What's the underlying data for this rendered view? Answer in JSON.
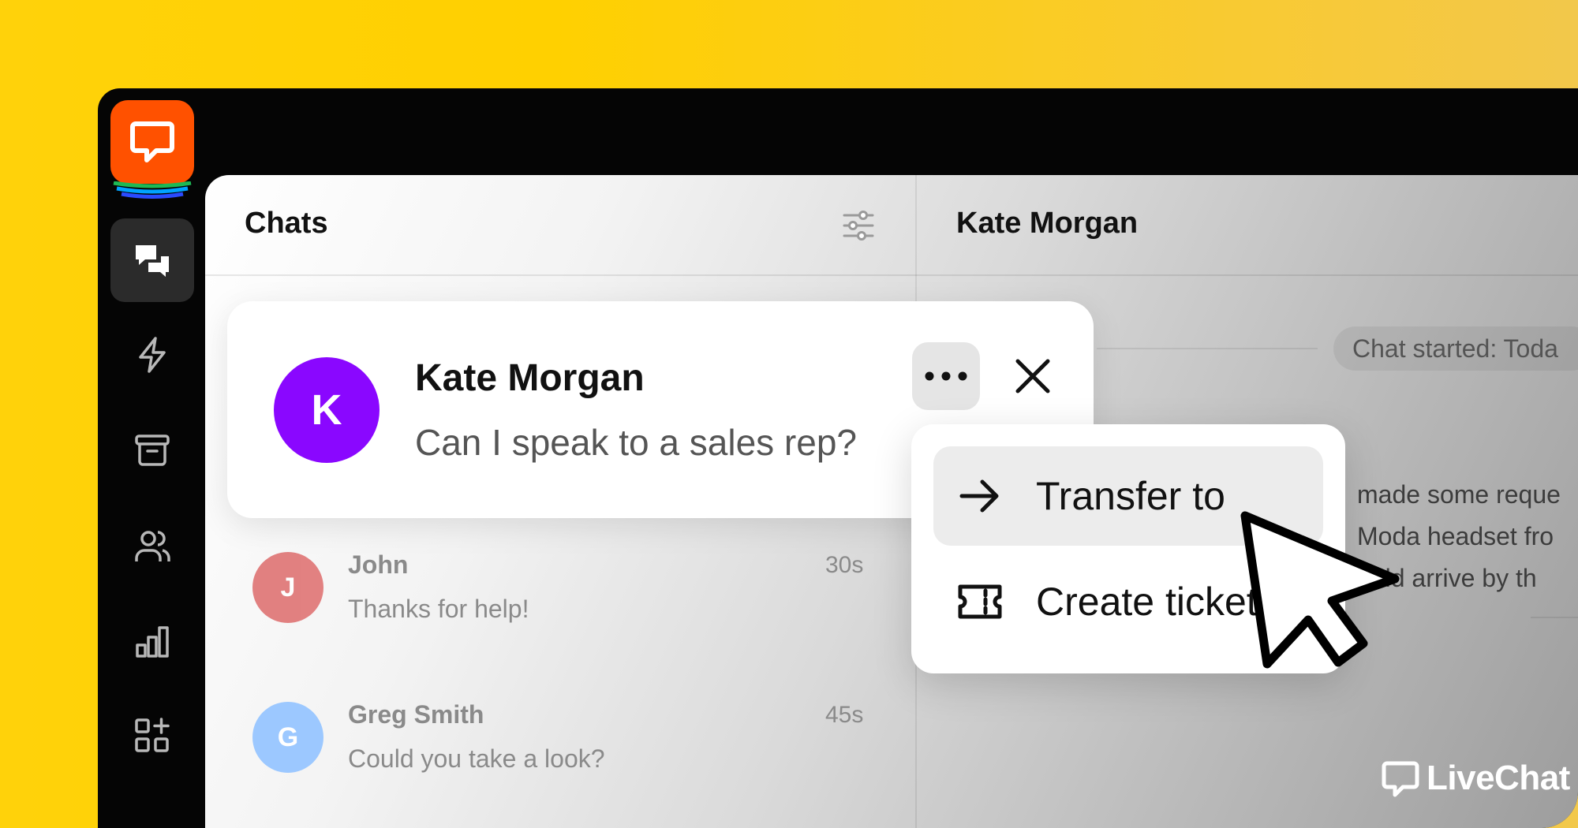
{
  "sidebar": {
    "nav": [
      {
        "name": "chats",
        "icon": "chat-bubbles-icon",
        "active": true
      },
      {
        "name": "automate",
        "icon": "lightning-icon",
        "active": false
      },
      {
        "name": "archives",
        "icon": "archive-box-icon",
        "active": false
      },
      {
        "name": "customers",
        "icon": "people-icon",
        "active": false
      },
      {
        "name": "reports",
        "icon": "bar-chart-icon",
        "active": false
      },
      {
        "name": "apps",
        "icon": "apps-grid-icon",
        "active": false
      }
    ]
  },
  "chat_list": {
    "title": "Chats",
    "filter_icon": "sliders-icon",
    "selected": {
      "initial": "K",
      "name": "Kate Morgan",
      "message": "Can I speak to a sales rep?",
      "avatar_color": "#8A07FF"
    },
    "items": [
      {
        "initial": "J",
        "name": "John",
        "time": "30s",
        "message": "Thanks for help!",
        "avatar_color": "#E07A7A"
      },
      {
        "initial": "G",
        "name": "Greg Smith",
        "time": "45s",
        "message": "Could you take a look?",
        "avatar_color": "#9CC8FF"
      }
    ]
  },
  "menu": {
    "items": [
      {
        "label": "Transfer to",
        "icon": "arrow-right-icon"
      },
      {
        "label": "Create ticket",
        "icon": "ticket-icon"
      }
    ]
  },
  "detail": {
    "title": "Kate Morgan",
    "started": "Chat started: Toda",
    "message_lines": [
      "made some reque",
      "Moda headset fro",
      "ould arrive by th"
    ]
  },
  "brand": {
    "name": "LiveChat",
    "logo_color": "#FF5100",
    "accent": "#FFD000"
  }
}
